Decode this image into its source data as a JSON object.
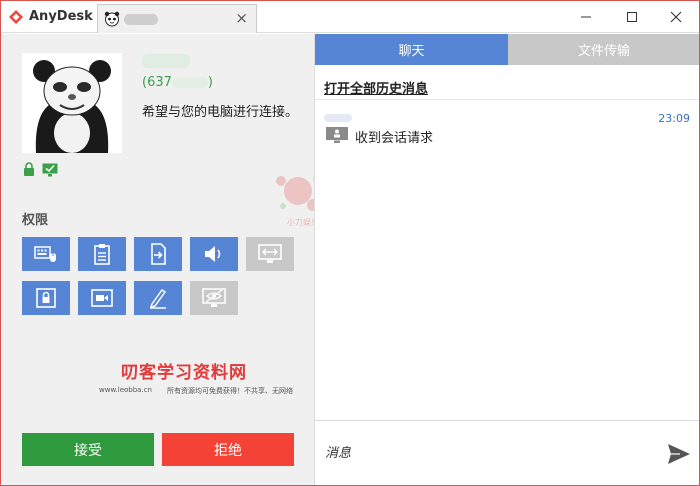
{
  "titlebar": {
    "app_name": "AnyDesk",
    "tab_close": "×"
  },
  "remote": {
    "id_prefix": "(637",
    "id_suffix": ")",
    "request_text": "希望与您的电脑进行连接。"
  },
  "permissions": {
    "title": "权限",
    "items": [
      {
        "name": "keyboard-mouse",
        "enabled": true
      },
      {
        "name": "clipboard",
        "enabled": true
      },
      {
        "name": "file-transfer",
        "enabled": true
      },
      {
        "name": "sound",
        "enabled": true
      },
      {
        "name": "control-screen",
        "enabled": false
      },
      {
        "name": "lock-screen",
        "enabled": true
      },
      {
        "name": "recording",
        "enabled": true
      },
      {
        "name": "draw",
        "enabled": true
      },
      {
        "name": "privacy-mode",
        "enabled": false
      }
    ]
  },
  "watermark": {
    "logo": "叨客学习资料网",
    "url": "www.leobba.cn",
    "note": "所有资源均可免费获得！不共享、无网络",
    "splash": "小刀娱乐 · 会员分享"
  },
  "actions": {
    "accept": "接受",
    "reject": "拒绝"
  },
  "chat": {
    "tab_chat": "聊天",
    "tab_files": "文件传输",
    "history_link": "打开全部历史消息",
    "message_time": "23:09",
    "message_text": "收到会话请求",
    "input_placeholder": "消息"
  },
  "colors": {
    "accent_blue": "#5585d4",
    "accept_green": "#2f9a3d",
    "reject_red": "#f44336",
    "disabled_gray": "#c8c8c8",
    "id_green": "#3aa14a"
  }
}
